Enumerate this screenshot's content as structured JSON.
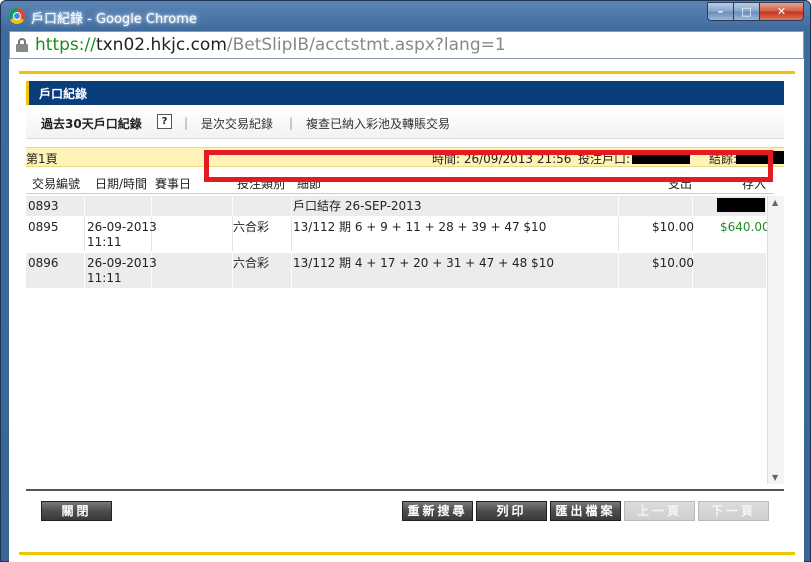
{
  "window": {
    "title": "戶口紀錄 - Google Chrome",
    "minimize_label": "–",
    "maximize_label": "□",
    "close_label": "✕"
  },
  "address": {
    "scheme": "https://",
    "host": "txn02.hkjc.com",
    "path": "/BetSlipIB/acctstmt.aspx?lang=1"
  },
  "header": {
    "title": "戶口紀錄"
  },
  "subtabs": {
    "current": "過去30天戶口紀錄",
    "help": "?",
    "separator": "|",
    "items": [
      "是次交易紀錄",
      "複查已納入彩池及轉賬交易"
    ]
  },
  "info": {
    "page": "第1頁",
    "time": "時間: 26/09/2013 21:56",
    "account_label": "投注戶口:",
    "balance_label": "結餘:"
  },
  "table": {
    "headers": [
      "交易編號",
      "日期/時間",
      "賽事日",
      "投注類別",
      "細節",
      "支出",
      "存入"
    ],
    "rows": [
      {
        "id": "0893",
        "date": "",
        "time": "",
        "race_day": "",
        "type": "",
        "detail": "戶口結存 26-SEP-2013",
        "debit": "",
        "credit": "",
        "balance_hidden": true
      },
      {
        "id": "0895",
        "date": "26-09-2013",
        "time": "11:11",
        "race_day": "",
        "type": "六合彩",
        "detail": "13/112 期  6 + 9 + 11 + 28 + 39 + 47  $10",
        "debit": "$10.00",
        "credit": "$640.00"
      },
      {
        "id": "0896",
        "date": "26-09-2013",
        "time": "11:11",
        "race_day": "",
        "type": "六合彩",
        "detail": "13/112 期  4 + 17 + 20 + 31 + 47 + 48  $10",
        "debit": "$10.00",
        "credit": ""
      }
    ]
  },
  "buttons": {
    "close": "關閉",
    "search_again": "重新搜尋",
    "print": "列印",
    "export": "匯出檔案",
    "prev_page": "上一頁",
    "next_page": "下一頁"
  },
  "colors": {
    "header_bg": "#0a3d7c",
    "accent_yellow": "#f0c400",
    "info_bar_bg": "#fdf3b6",
    "credit_text": "#2a8a2a",
    "highlight_border": "#e21a22"
  }
}
